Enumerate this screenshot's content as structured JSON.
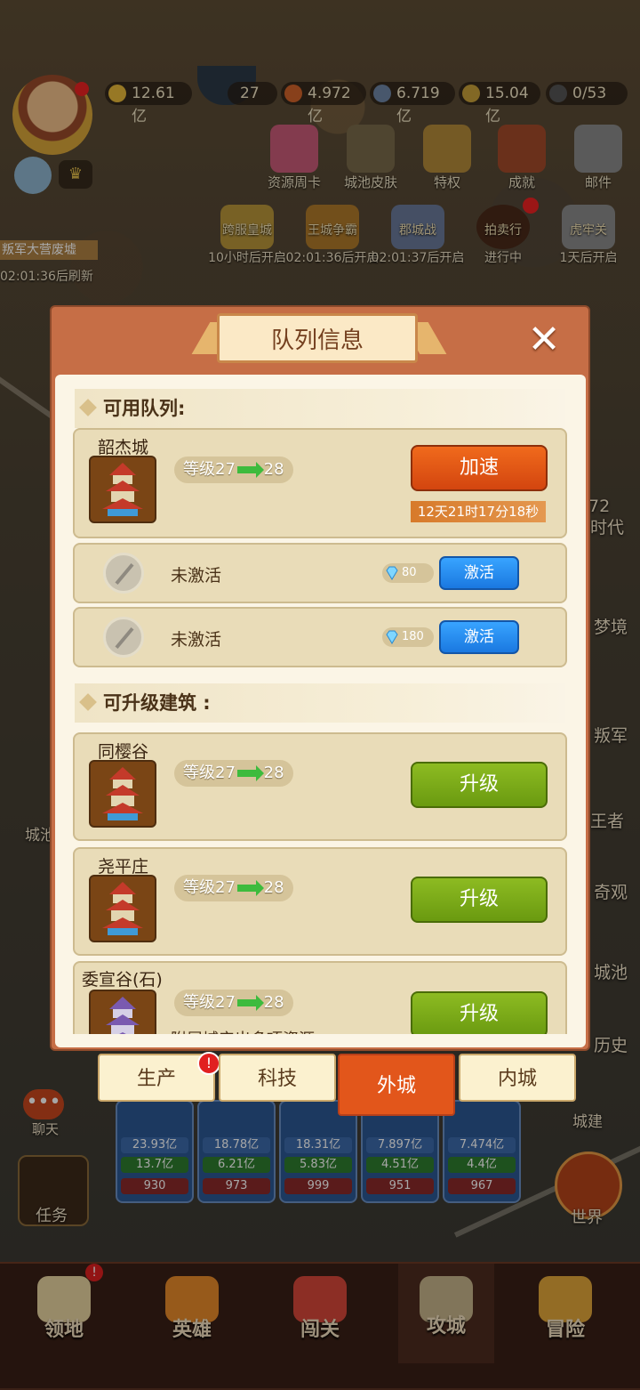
{
  "hud": {
    "resources": [
      {
        "icon": "gold-coin-icon",
        "value": "12.61亿",
        "color": "#e8b83a"
      },
      {
        "icon": "gem-icon",
        "value": "27",
        "color": "#5bc0f0"
      },
      {
        "icon": "food-icon",
        "value": "4.972亿",
        "color": "#d2632a"
      },
      {
        "icon": "stone-icon",
        "value": "6.719亿",
        "color": "#6f86a7"
      },
      {
        "icon": "wood-icon",
        "value": "15.04亿",
        "color": "#c8a03a"
      },
      {
        "icon": "soldier-icon",
        "value": "0/53",
        "color": "#555555"
      }
    ],
    "top_icons": [
      "资源周卡",
      "城池皮肤",
      "特权",
      "成就",
      "邮件"
    ],
    "events": [
      {
        "name": "跨服皇城",
        "time": "10小时后开启"
      },
      {
        "name": "王城争霸",
        "time": "02:01:36后开启"
      },
      {
        "name": "郡城战",
        "time": "02:01:37后开启"
      },
      {
        "name": "拍卖行",
        "time": "进行中"
      },
      {
        "name": "虎牢关",
        "time": "1天后开启"
      }
    ],
    "left_banner": "叛军大营废墟",
    "left_banner_time": "02:01:36后刷新",
    "right_side": [
      "72",
      "时代",
      "梦境",
      "叛军",
      "王者",
      "奇观",
      "城池",
      "历史",
      "城建"
    ],
    "left_side": [
      "城池",
      "聊天",
      "任务"
    ],
    "world_label": "世界"
  },
  "modal": {
    "title": "队列信息",
    "close_glyph": "✕",
    "available_header": "可用队列:",
    "upgradable_header": "可升级建筑 :",
    "active_queue": {
      "name": "韶杰城",
      "level_from": "等级27",
      "level_to": "28",
      "button": "加速",
      "timer": "12天21时17分18秒"
    },
    "locked_queues": [
      {
        "label": "未激活",
        "cost": "80",
        "button": "激活"
      },
      {
        "label": "未激活",
        "cost": "180",
        "button": "激活"
      }
    ],
    "buildings": [
      {
        "name": "同樱谷",
        "level_from": "等级27",
        "level_to": "28",
        "button": "升级"
      },
      {
        "name": "尧平庄",
        "level_from": "等级27",
        "level_to": "28",
        "button": "升级"
      },
      {
        "name": "委宣谷(石)",
        "level_from": "等级27",
        "level_to": "28",
        "button": "升级",
        "note": "附属城产出多项资源"
      }
    ]
  },
  "tabs": [
    {
      "label": "生产",
      "badge": "!"
    },
    {
      "label": "科技"
    },
    {
      "label": "外城",
      "active": true
    },
    {
      "label": "内城"
    }
  ],
  "hero_cards": [
    {
      "power": "23.93亿",
      "stat": "13.7亿",
      "level": "930"
    },
    {
      "power": "18.78亿",
      "stat": "6.21亿",
      "level": "973"
    },
    {
      "power": "18.31亿",
      "stat": "5.83亿",
      "level": "999"
    },
    {
      "power": "7.897亿",
      "stat": "4.51亿",
      "level": "951"
    },
    {
      "power": "7.474亿",
      "stat": "4.4亿",
      "level": "967"
    }
  ],
  "bottom_nav": [
    {
      "label": "领地",
      "icon": "territory-icon",
      "badge": "!"
    },
    {
      "label": "英雄",
      "icon": "hero-icon"
    },
    {
      "label": "闯关",
      "icon": "gate-icon"
    },
    {
      "label": "攻城",
      "icon": "siege-map-icon",
      "active": true
    },
    {
      "label": "冒险",
      "icon": "adventure-icon"
    }
  ]
}
